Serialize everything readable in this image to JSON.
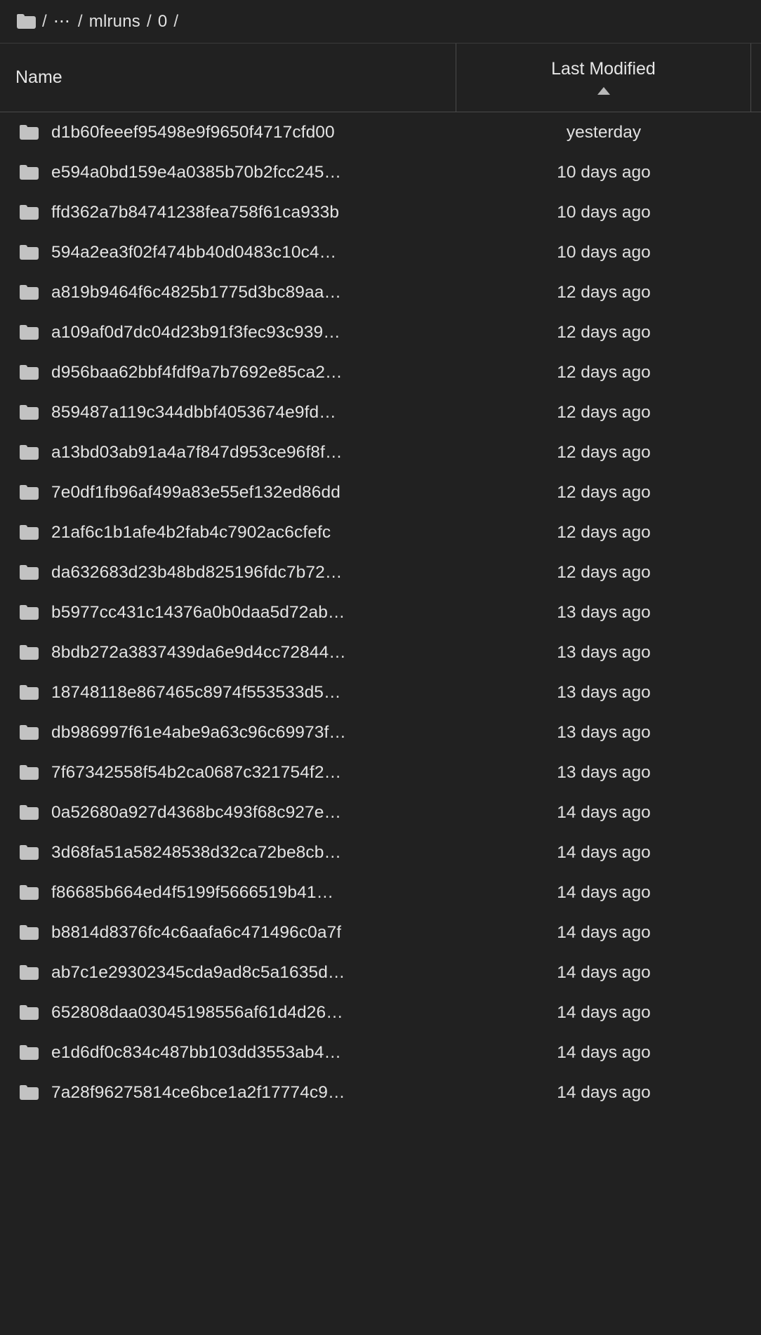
{
  "breadcrumb": {
    "root_icon": "folder-icon",
    "separator": "/",
    "ellipsis": "⋯",
    "items": [
      "mlruns",
      "0"
    ]
  },
  "table": {
    "columns": [
      {
        "key": "name",
        "label": "Name"
      },
      {
        "key": "last_modified",
        "label": "Last Modified",
        "sort": "ascending",
        "sort_icon": "caret-up-icon"
      }
    ],
    "rows": [
      {
        "icon": "folder-icon",
        "name": "d1b60feeef95498e9f9650f4717cfd00",
        "last_modified": "yesterday"
      },
      {
        "icon": "folder-icon",
        "name": "e594a0bd159e4a0385b70b2fcc245…",
        "last_modified": "10 days ago"
      },
      {
        "icon": "folder-icon",
        "name": "ffd362a7b84741238fea758f61ca933b",
        "last_modified": "10 days ago"
      },
      {
        "icon": "folder-icon",
        "name": "594a2ea3f02f474bb40d0483c10c4…",
        "last_modified": "10 days ago"
      },
      {
        "icon": "folder-icon",
        "name": "a819b9464f6c4825b1775d3bc89aa…",
        "last_modified": "12 days ago"
      },
      {
        "icon": "folder-icon",
        "name": "a109af0d7dc04d23b91f3fec93c939…",
        "last_modified": "12 days ago"
      },
      {
        "icon": "folder-icon",
        "name": "d956baa62bbf4fdf9a7b7692e85ca2…",
        "last_modified": "12 days ago"
      },
      {
        "icon": "folder-icon",
        "name": "859487a119c344dbbf4053674e9fd…",
        "last_modified": "12 days ago"
      },
      {
        "icon": "folder-icon",
        "name": "a13bd03ab91a4a7f847d953ce96f8f…",
        "last_modified": "12 days ago"
      },
      {
        "icon": "folder-icon",
        "name": "7e0df1fb96af499a83e55ef132ed86dd",
        "last_modified": "12 days ago"
      },
      {
        "icon": "folder-icon",
        "name": "21af6c1b1afe4b2fab4c7902ac6cfefc",
        "last_modified": "12 days ago"
      },
      {
        "icon": "folder-icon",
        "name": "da632683d23b48bd825196fdc7b72…",
        "last_modified": "12 days ago"
      },
      {
        "icon": "folder-icon",
        "name": "b5977cc431c14376a0b0daa5d72ab…",
        "last_modified": "13 days ago"
      },
      {
        "icon": "folder-icon",
        "name": "8bdb272a3837439da6e9d4cc72844…",
        "last_modified": "13 days ago"
      },
      {
        "icon": "folder-icon",
        "name": "18748118e867465c8974f553533d5…",
        "last_modified": "13 days ago"
      },
      {
        "icon": "folder-icon",
        "name": "db986997f61e4abe9a63c96c69973f…",
        "last_modified": "13 days ago"
      },
      {
        "icon": "folder-icon",
        "name": "7f67342558f54b2ca0687c321754f2…",
        "last_modified": "13 days ago"
      },
      {
        "icon": "folder-icon",
        "name": "0a52680a927d4368bc493f68c927e…",
        "last_modified": "14 days ago"
      },
      {
        "icon": "folder-icon",
        "name": "3d68fa51a58248538d32ca72be8cb…",
        "last_modified": "14 days ago"
      },
      {
        "icon": "folder-icon",
        "name": "f86685b664ed4f5199f5666519b41…",
        "last_modified": "14 days ago"
      },
      {
        "icon": "folder-icon",
        "name": "b8814d8376fc4c6aafa6c471496c0a7f",
        "last_modified": "14 days ago"
      },
      {
        "icon": "folder-icon",
        "name": "ab7c1e29302345cda9ad8c5a1635d…",
        "last_modified": "14 days ago"
      },
      {
        "icon": "folder-icon",
        "name": "652808daa03045198556af61d4d26…",
        "last_modified": "14 days ago"
      },
      {
        "icon": "folder-icon",
        "name": "e1d6df0c834c487bb103dd3553ab4…",
        "last_modified": "14 days ago"
      },
      {
        "icon": "folder-icon",
        "name": "7a28f96275814ce6bce1a2f17774c9…",
        "last_modified": "14 days ago"
      }
    ]
  },
  "colors": {
    "background": "#212121",
    "text": "#e4e4e4",
    "icon": "#c2c2c2",
    "divider": "#4a4a4a"
  }
}
